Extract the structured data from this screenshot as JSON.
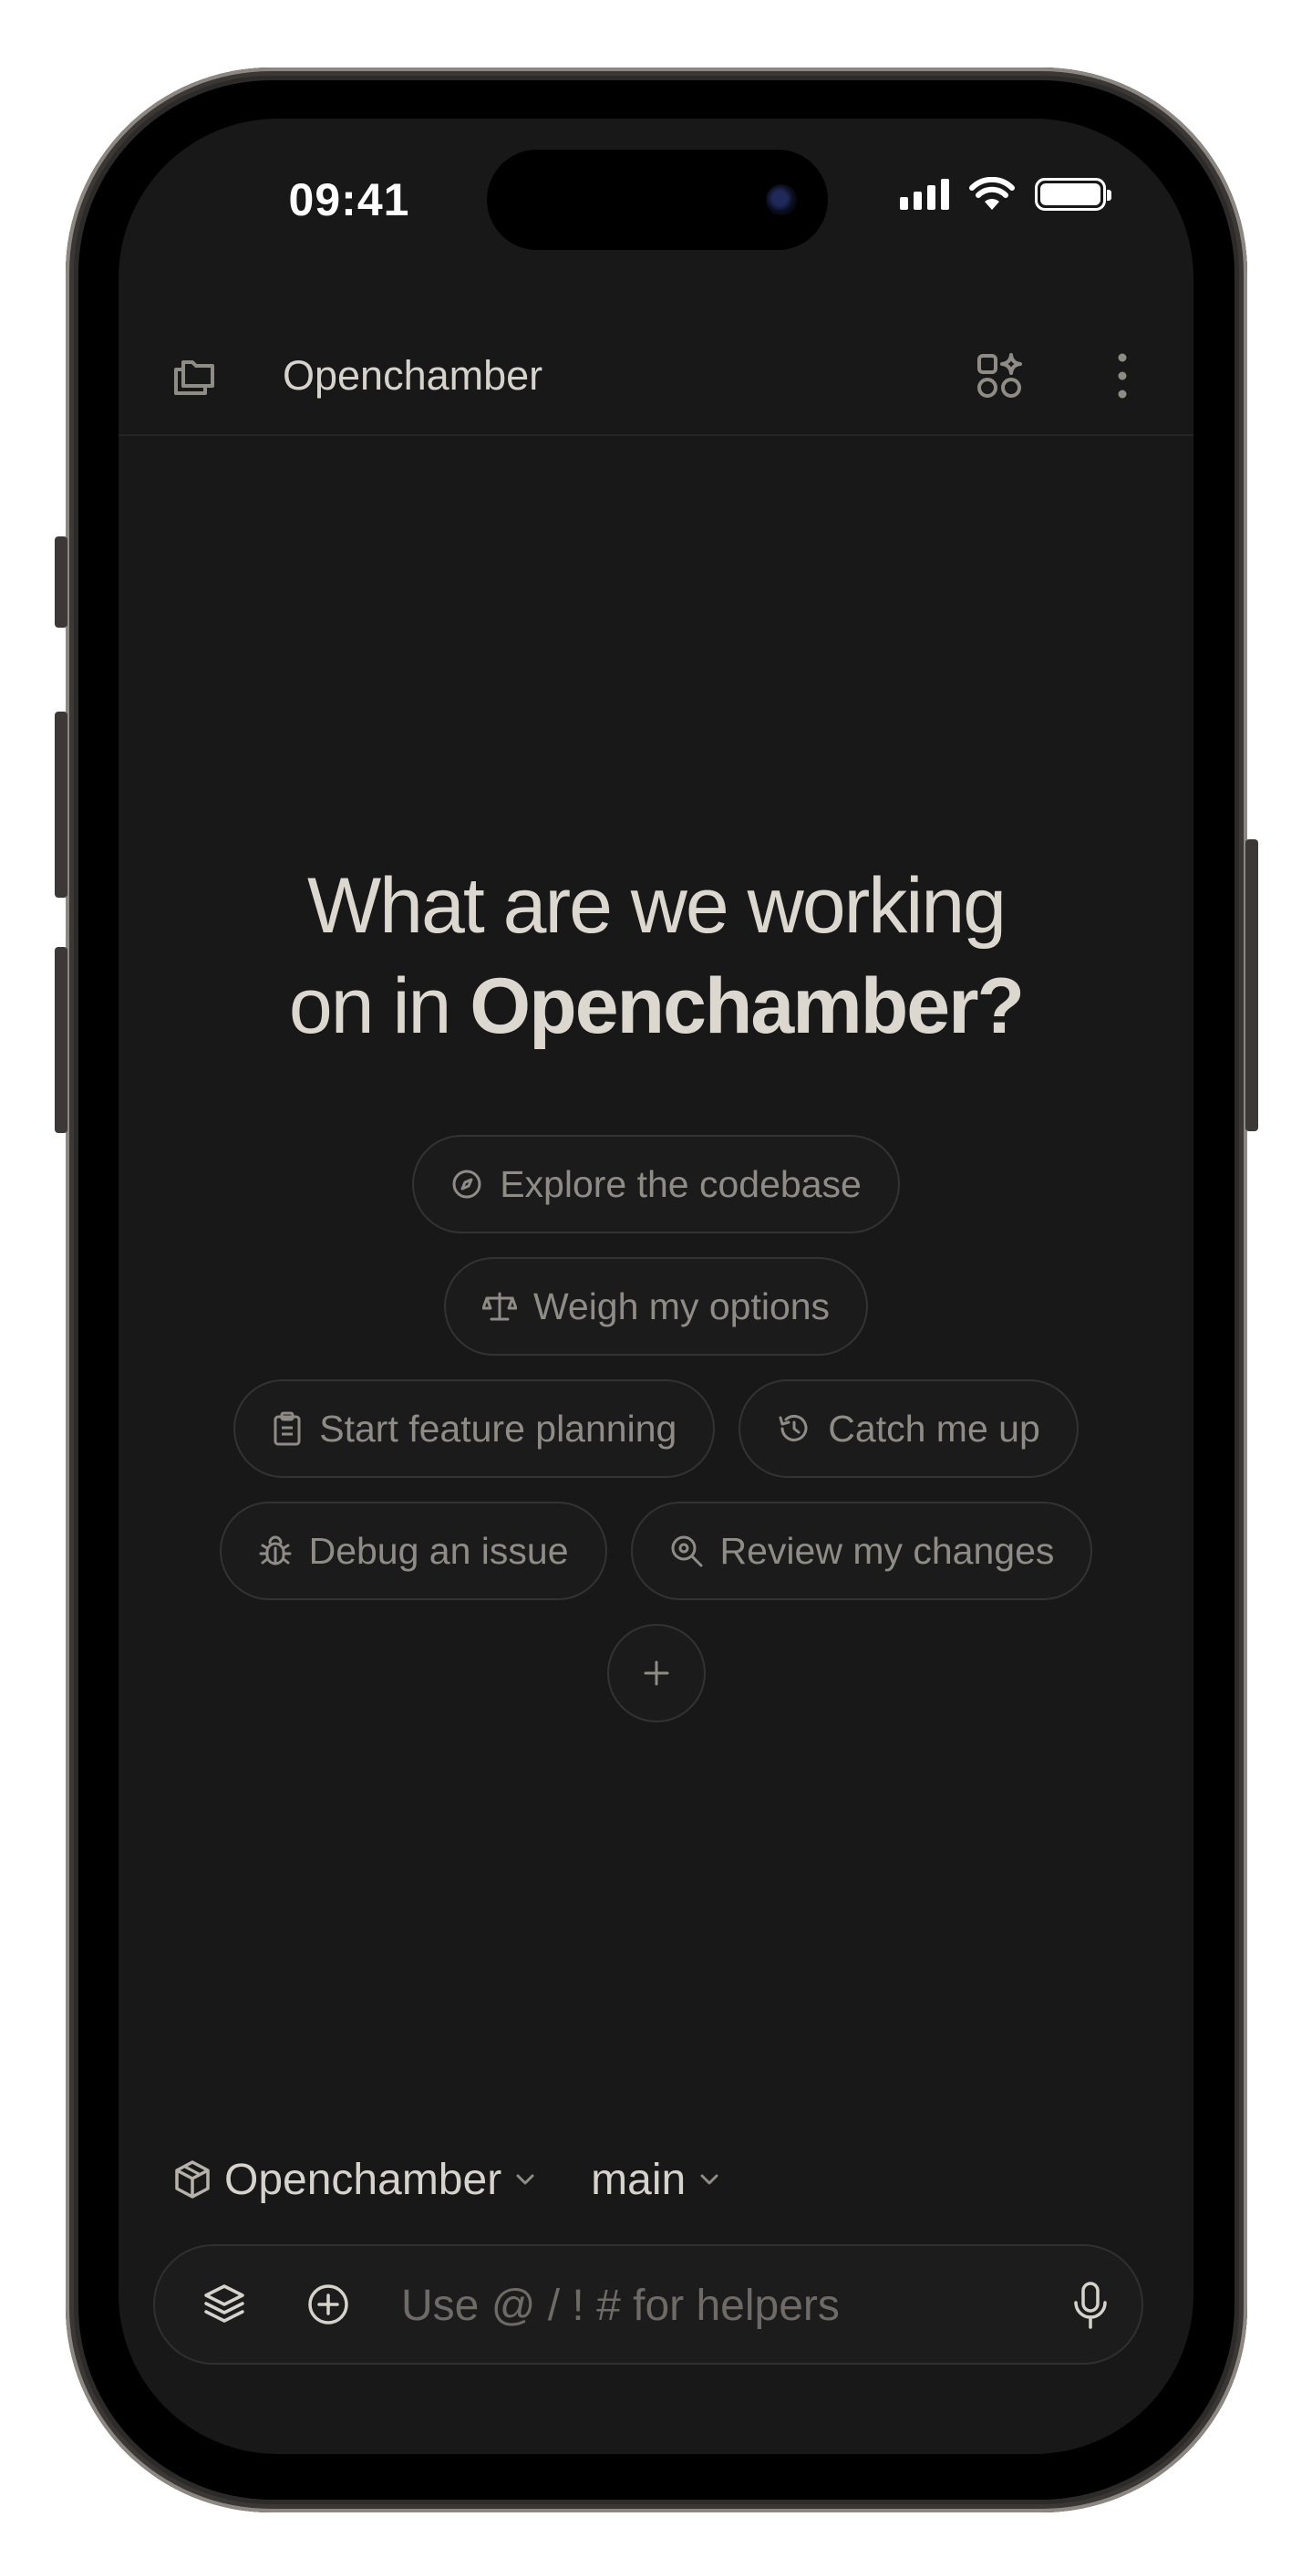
{
  "status_bar": {
    "time": "09:41",
    "icons": [
      "signal-icon",
      "wifi-icon",
      "battery-icon"
    ]
  },
  "header": {
    "title": "Opencham­ber",
    "icons": {
      "left": "sessions-icon",
      "apps": "apps-sparkle-icon",
      "more": "more-vertical-icon"
    }
  },
  "hero": {
    "line1": "What are we working",
    "line2_prefix": "on in ",
    "line2_project": "Opencham­ber?"
  },
  "suggestions": [
    {
      "label": "Explore the codebase",
      "icon": "compass-icon"
    },
    {
      "label": "Weigh my options",
      "icon": "scale-icon"
    },
    {
      "label": "Start feature planning",
      "icon": "clipboard-icon"
    },
    {
      "label": "Catch me up",
      "icon": "history-icon"
    },
    {
      "label": "Debug an issue",
      "icon": "bug-icon"
    },
    {
      "label": "Review my changes",
      "icon": "search-review-icon"
    }
  ],
  "add_suggestion_icon": "plus-icon",
  "context": {
    "project": "Opencham­ber",
    "branch": "main"
  },
  "composer": {
    "placeholder": "Use @ / ! # for helpers",
    "value": ""
  },
  "colors": {
    "background": "#181818",
    "text": "#d6d3cc",
    "muted": "#8f8c86",
    "border": "#333333"
  }
}
